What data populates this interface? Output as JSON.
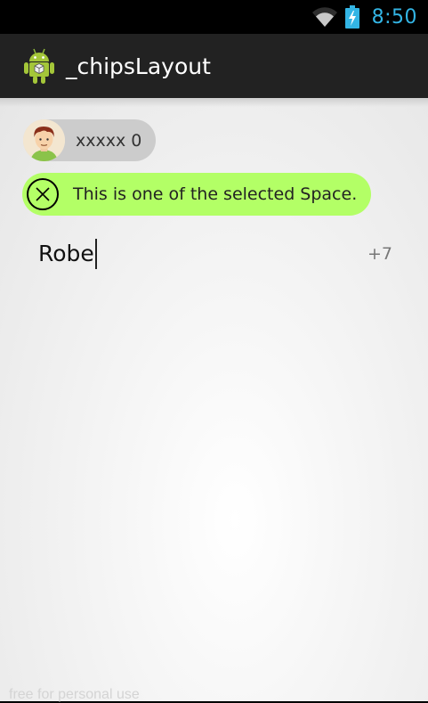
{
  "status_bar": {
    "time": "8:50",
    "icons": [
      "wifi-icon",
      "battery-charging-icon"
    ],
    "accent_color": "#33b5e5"
  },
  "action_bar": {
    "title": "_chipsLayout",
    "icon": "android-robot-icon",
    "background": "#222222"
  },
  "chips": [
    {
      "label": "xxxxx 0",
      "icon": "avatar-icon",
      "color": "#cccccc"
    },
    {
      "label": "This is one of the selected Space.",
      "icon": "close-icon",
      "color": "#b3ff66"
    }
  ],
  "input": {
    "value": "Robe",
    "more_count": "+7"
  },
  "watermark": "free for personal use"
}
